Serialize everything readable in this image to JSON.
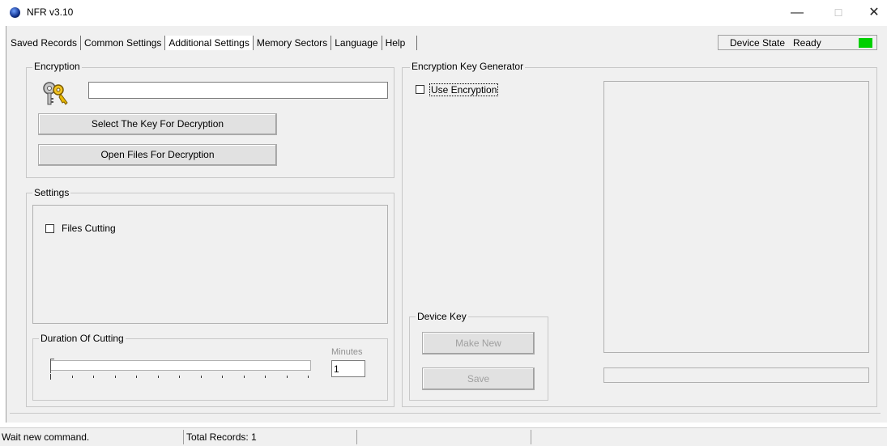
{
  "window": {
    "title": "NFR v3.10",
    "controls": {
      "minimize": "—",
      "maximize": "☐",
      "close": "✕"
    }
  },
  "tabs": [
    {
      "label": "Saved Records"
    },
    {
      "label": "Common Settings"
    },
    {
      "label": "Additional Settings",
      "active": true
    },
    {
      "label": "Memory Sectors"
    },
    {
      "label": "Language"
    },
    {
      "label": "Help"
    }
  ],
  "device_state": {
    "label": "Device State",
    "value": "Ready",
    "indicator_color": "#00d000"
  },
  "encryption": {
    "group_label": "Encryption",
    "key_path_value": "",
    "select_key_button": "Select The Key For Decryption",
    "open_files_button": "Open Files For Decryption",
    "icon": "keys-icon"
  },
  "settings": {
    "group_label": "Settings",
    "files_cutting_label": "Files Cutting",
    "files_cutting_checked": false
  },
  "duration": {
    "group_label": "Duration Of Cutting",
    "minutes_label": "Minutes",
    "minutes_value": "1",
    "slider_value": 1,
    "tick_count": 13
  },
  "key_generator": {
    "group_label": "Encryption Key Generator",
    "use_encryption_label": "Use Encryption",
    "use_encryption_checked": false,
    "device_key": {
      "group_label": "Device Key",
      "make_new_button": "Make New",
      "save_button": "Save"
    }
  },
  "status_bar": {
    "message": "Wait new command.",
    "total_records": "Total Records: 1"
  }
}
